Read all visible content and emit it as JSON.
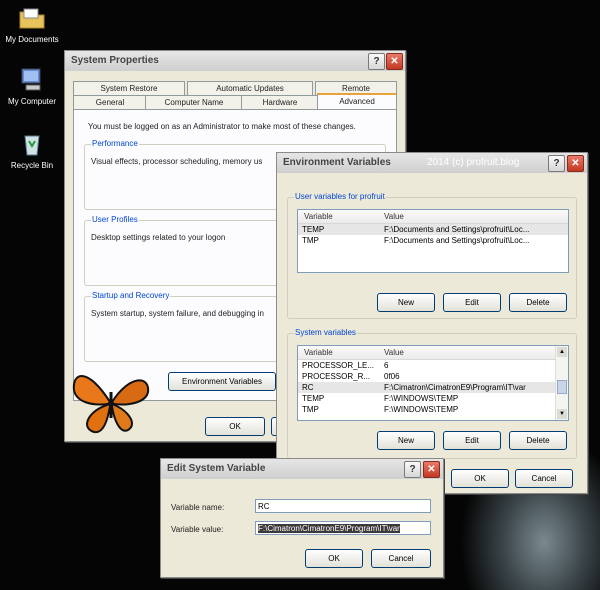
{
  "desktop": {
    "icons": [
      {
        "label": "My Documents"
      },
      {
        "label": "My Computer"
      },
      {
        "label": "Recycle Bin"
      }
    ]
  },
  "system_properties": {
    "title": "System Properties",
    "tabs_row1": [
      "System Restore",
      "Automatic Updates",
      "Remote"
    ],
    "tabs_row2": [
      "General",
      "Computer Name",
      "Hardware",
      "Advanced"
    ],
    "admin_note": "You must be logged on as an Administrator to make most of these changes.",
    "performance": {
      "label": "Performance",
      "text": "Visual effects, processor scheduling, memory us"
    },
    "user_profiles": {
      "label": "User Profiles",
      "text": "Desktop settings related to your logon"
    },
    "startup": {
      "label": "Startup and Recovery",
      "text": "System startup, system failure, and debugging in"
    },
    "env_button": "Environment Variables",
    "ok": "OK"
  },
  "env_vars": {
    "title": "Environment Variables",
    "watermark": "2014 (c) profruit.blog",
    "user_group_label": "User variables for profruit",
    "columns": [
      "Variable",
      "Value"
    ],
    "user_rows": [
      {
        "var": "TEMP",
        "val": "F:\\Documents and Settings\\profruit\\Loc..."
      },
      {
        "var": "TMP",
        "val": "F:\\Documents and Settings\\profruit\\Loc..."
      }
    ],
    "sys_group_label": "System variables",
    "sys_rows": [
      {
        "var": "PROCESSOR_LE...",
        "val": "6"
      },
      {
        "var": "PROCESSOR_R...",
        "val": "0f06"
      },
      {
        "var": "RC",
        "val": "F:\\Cimatron\\CimatronE9\\Program\\IT\\var"
      },
      {
        "var": "TEMP",
        "val": "F:\\WINDOWS\\TEMP"
      },
      {
        "var": "TMP",
        "val": "F:\\WINDOWS\\TEMP"
      }
    ],
    "new": "New",
    "edit": "Edit",
    "delete": "Delete",
    "ok": "OK",
    "cancel": "Cancel"
  },
  "edit_var": {
    "title": "Edit System Variable",
    "name_label": "Variable name:",
    "name_value": "RC",
    "value_label": "Variable value:",
    "value_value": "F:\\Cimatron\\CimatronE9\\Program\\IT\\var",
    "ok": "OK",
    "cancel": "Cancel"
  },
  "colors": {
    "accent": "#0046d5",
    "close": "#c23a22",
    "tab_active": "#e8a23b",
    "desktop": "#050505"
  }
}
